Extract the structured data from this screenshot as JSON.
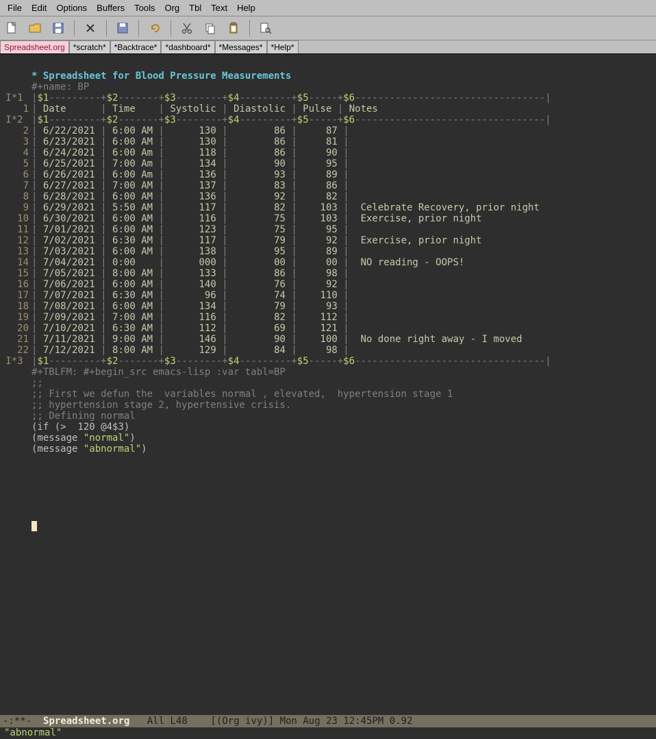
{
  "menu": [
    "File",
    "Edit",
    "Options",
    "Buffers",
    "Tools",
    "Org",
    "Tbl",
    "Text",
    "Help"
  ],
  "toolbar_icons": [
    "new-file",
    "open-file",
    "save-file",
    "close",
    "save-as",
    "undo",
    "cut",
    "copy",
    "paste",
    "search"
  ],
  "tabs": [
    {
      "label": "Spreadsheet.org",
      "active": true
    },
    {
      "label": "*scratch*",
      "active": false
    },
    {
      "label": "*Backtrace*",
      "active": false
    },
    {
      "label": "*dashboard*",
      "active": false
    },
    {
      "label": "*Messages*",
      "active": false
    },
    {
      "label": "*Help*",
      "active": false
    }
  ],
  "doc": {
    "title": "* Spreadsheet for Blood Pressure Measurements",
    "name_line": "#+name: BP",
    "headers": [
      "Date",
      "Time",
      "Systolic",
      "Diastolic",
      "Pulse",
      "Notes"
    ],
    "rows": [
      {
        "n": 2,
        "date": "6/22/2021",
        "time": "6:00 AM",
        "sys": "130",
        "dia": "86",
        "pulse": "87",
        "notes": ""
      },
      {
        "n": 3,
        "date": "6/23/2021",
        "time": "6:00 AM",
        "sys": "130",
        "dia": "86",
        "pulse": "81",
        "notes": ""
      },
      {
        "n": 4,
        "date": "6/24/2021",
        "time": "6:00 Am",
        "sys": "118",
        "dia": "86",
        "pulse": "90",
        "notes": ""
      },
      {
        "n": 5,
        "date": "6/25/2021",
        "time": "7:00 Am",
        "sys": "134",
        "dia": "90",
        "pulse": "95",
        "notes": ""
      },
      {
        "n": 6,
        "date": "6/26/2021",
        "time": "6:00 Am",
        "sys": "136",
        "dia": "93",
        "pulse": "89",
        "notes": ""
      },
      {
        "n": 7,
        "date": "6/27/2021",
        "time": "7:00 AM",
        "sys": "137",
        "dia": "83",
        "pulse": "86",
        "notes": ""
      },
      {
        "n": 8,
        "date": "6/28/2021",
        "time": "6:00 AM",
        "sys": "136",
        "dia": "92",
        "pulse": "82",
        "notes": ""
      },
      {
        "n": 9,
        "date": "6/29/2021",
        "time": "5:50 AM",
        "sys": "117",
        "dia": "82",
        "pulse": "103",
        "notes": "Celebrate Recovery, prior night"
      },
      {
        "n": 10,
        "date": "6/30/2021",
        "time": "6:00 AM",
        "sys": "116",
        "dia": "75",
        "pulse": "103",
        "notes": "Exercise, prior night"
      },
      {
        "n": 11,
        "date": "7/01/2021",
        "time": "6:00 AM",
        "sys": "123",
        "dia": "75",
        "pulse": "95",
        "notes": ""
      },
      {
        "n": 12,
        "date": "7/02/2021",
        "time": "6:30 AM",
        "sys": "117",
        "dia": "79",
        "pulse": "92",
        "notes": "Exercise, prior night"
      },
      {
        "n": 13,
        "date": "7/03/2021",
        "time": "6:00 AM",
        "sys": "138",
        "dia": "95",
        "pulse": "89",
        "notes": ""
      },
      {
        "n": 14,
        "date": "7/04/2021",
        "time": "0:00",
        "sys": "000",
        "dia": "00",
        "pulse": "00",
        "notes": "NO reading - OOPS!"
      },
      {
        "n": 15,
        "date": "7/05/2021",
        "time": "8:00 AM",
        "sys": "133",
        "dia": "86",
        "pulse": "98",
        "notes": ""
      },
      {
        "n": 16,
        "date": "7/06/2021",
        "time": "6:00 AM",
        "sys": "140",
        "dia": "76",
        "pulse": "92",
        "notes": ""
      },
      {
        "n": 17,
        "date": "7/07/2021",
        "time": "6:30 AM",
        "sys": "96",
        "dia": "74",
        "pulse": "110",
        "notes": ""
      },
      {
        "n": 18,
        "date": "7/08/2021",
        "time": "6:00 AM",
        "sys": "134",
        "dia": "79",
        "pulse": "93",
        "notes": ""
      },
      {
        "n": 19,
        "date": "7/09/2021",
        "time": "7:00 AM",
        "sys": "116",
        "dia": "82",
        "pulse": "112",
        "notes": ""
      },
      {
        "n": 20,
        "date": "7/10/2021",
        "time": "6:30 AM",
        "sys": "112",
        "dia": "69",
        "pulse": "121",
        "notes": ""
      },
      {
        "n": 21,
        "date": "7/11/2021",
        "time": "9:00 AM",
        "sys": "146",
        "dia": "90",
        "pulse": "100",
        "notes": "No done right away - I moved"
      },
      {
        "n": 22,
        "date": "7/12/2021",
        "time": "8:00 AM",
        "sys": "129",
        "dia": "84",
        "pulse": "98",
        "notes": ""
      }
    ],
    "tblfm": "#+TBLFM: #+begin_src emacs-lisp :var tabl=BP",
    "code": [
      ";;",
      ";; First we defun the  variables normal , elevated,  hypertension stage 1",
      ";; hypertension stage 2, hypertensive crisis.",
      "",
      ";; Defining normal",
      "",
      "",
      "(if (>  120 @4$3)",
      "(message \"normal\")",
      "(message \"abnormal\")"
    ]
  },
  "mode_line": {
    "left": "-:**-",
    "buffer": "Spreadsheet.org",
    "pos": "All L48",
    "mode": "[(Org ivy)]",
    "time": "Mon Aug 23 12:45PM 0.92"
  },
  "minibuffer": "\"abnormal\""
}
